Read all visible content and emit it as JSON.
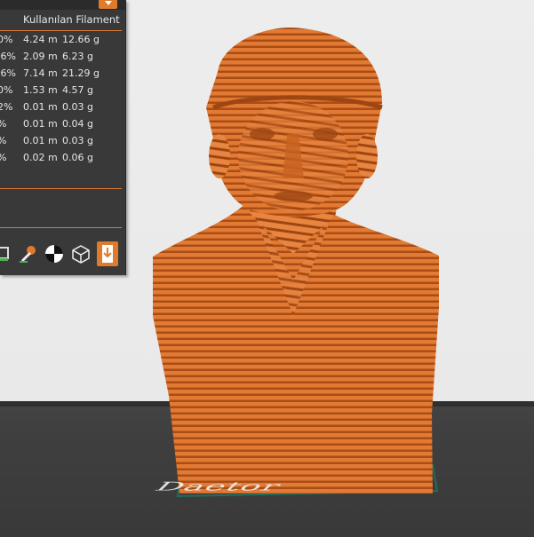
{
  "filament_table": {
    "header": "Kullanılan Filament",
    "rows": [
      {
        "pct": "0%",
        "length": "4.24 m",
        "weight": "12.66 g"
      },
      {
        "pct": ".6%",
        "length": "2.09 m",
        "weight": "6.23 g"
      },
      {
        "pct": ".6%",
        "length": "7.14 m",
        "weight": "21.29 g"
      },
      {
        "pct": "0%",
        "length": "1.53 m",
        "weight": "4.57 g"
      },
      {
        "pct": "2%",
        "length": "0.01 m",
        "weight": "0.03 g"
      },
      {
        "pct": "%",
        "length": "0.01 m",
        "weight": "0.04 g"
      },
      {
        "pct": "%",
        "length": "0.01 m",
        "weight": "0.03 g"
      },
      {
        "pct": "%",
        "length": "0.02 m",
        "weight": "0.06 g"
      }
    ]
  },
  "toolbar": {
    "icons": [
      "filament-icon",
      "paint-brush-icon",
      "center-of-gravity-icon",
      "cube-wireframe-icon",
      "export-download-icon"
    ]
  },
  "colors": {
    "accent": "#e07a2c",
    "panel_bg": "#393939",
    "model_orange": "#e37a33",
    "bed_dark": "#3f3f3f",
    "bed_outline": "#1f6e5e"
  },
  "viewport": {
    "plate_label": "Daetor"
  }
}
